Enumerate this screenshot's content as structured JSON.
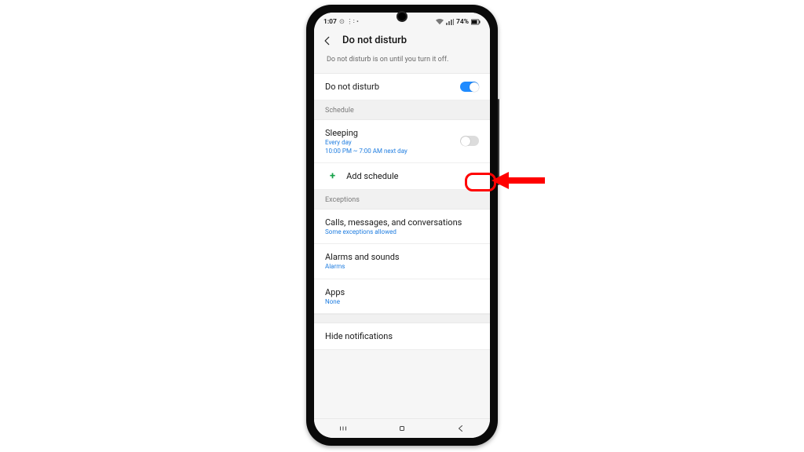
{
  "status": {
    "time": "1:07",
    "left_icons": "⊙ ⋮∶ •",
    "battery_text": "74%"
  },
  "header": {
    "title": "Do not disturb"
  },
  "banner": "Do not disturb is on until you turn it off.",
  "dnd_row": {
    "label": "Do not disturb",
    "on": true
  },
  "sections": {
    "schedule_header": "Schedule",
    "exceptions_header": "Exceptions"
  },
  "schedule": {
    "sleeping": {
      "label": "Sleeping",
      "sub": "Every day",
      "sub2": "10:00 PM ~ 7:00 AM next day",
      "on": false
    },
    "add_label": "Add schedule"
  },
  "exceptions": {
    "calls": {
      "label": "Calls, messages, and conversations",
      "sub": "Some exceptions allowed"
    },
    "alarms": {
      "label": "Alarms and sounds",
      "sub": "Alarms"
    },
    "apps": {
      "label": "Apps",
      "sub": "None"
    }
  },
  "hide_notifications_label": "Hide notifications",
  "annotation": {
    "color": "#ff0000"
  }
}
